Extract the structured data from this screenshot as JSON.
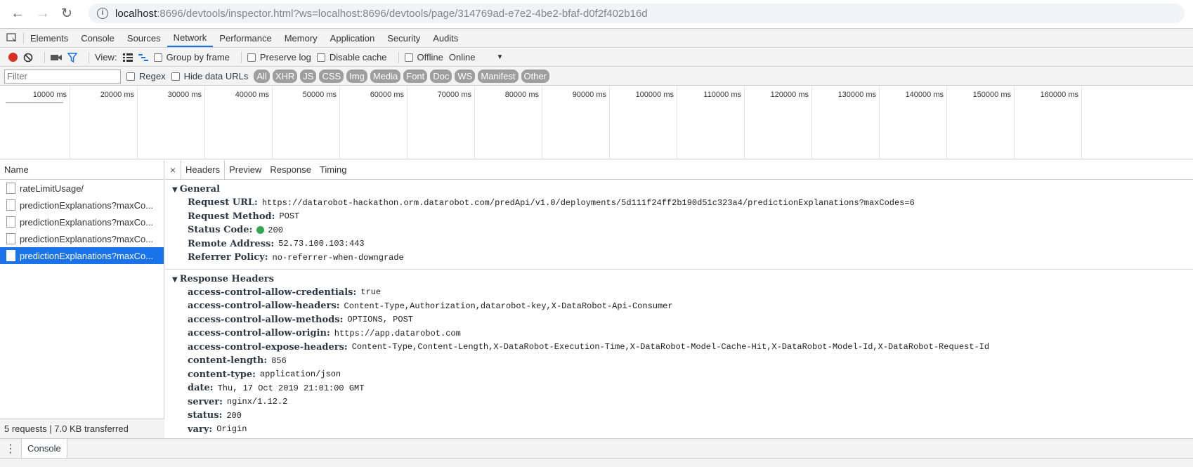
{
  "browser": {
    "url_host": "localhost",
    "url_rest": ":8696/devtools/inspector.html?ws=localhost:8696/devtools/page/314769ad-e7e2-4be2-bfaf-d0f2f402b16d"
  },
  "devtools_tabs": [
    "Elements",
    "Console",
    "Sources",
    "Network",
    "Performance",
    "Memory",
    "Application",
    "Security",
    "Audits"
  ],
  "active_tab": "Network",
  "toolbar": {
    "view_label": "View:",
    "group_by_frame": "Group by frame",
    "preserve_log": "Preserve log",
    "disable_cache": "Disable cache",
    "offline": "Offline",
    "throttle": "Online"
  },
  "filterbar": {
    "placeholder": "Filter",
    "regex": "Regex",
    "hide_data_urls": "Hide data URLs",
    "types": [
      "All",
      "XHR",
      "JS",
      "CSS",
      "Img",
      "Media",
      "Font",
      "Doc",
      "WS",
      "Manifest",
      "Other"
    ]
  },
  "timeline_ticks": [
    "10000 ms",
    "20000 ms",
    "30000 ms",
    "40000 ms",
    "50000 ms",
    "60000 ms",
    "70000 ms",
    "80000 ms",
    "90000 ms",
    "100000 ms",
    "110000 ms",
    "120000 ms",
    "130000 ms",
    "140000 ms",
    "150000 ms",
    "160000 ms"
  ],
  "requests": {
    "header": "Name",
    "items": [
      {
        "name": "rateLimitUsage/"
      },
      {
        "name": "predictionExplanations?maxCo..."
      },
      {
        "name": "predictionExplanations?maxCo..."
      },
      {
        "name": "predictionExplanations?maxCo..."
      },
      {
        "name": "predictionExplanations?maxCo..."
      }
    ],
    "selected_index": 4,
    "footer": "5 requests | 7.0 KB transferred"
  },
  "detail": {
    "tabs": [
      "Headers",
      "Preview",
      "Response",
      "Timing"
    ],
    "active_tab": "Headers",
    "general": {
      "title": "General",
      "rows": [
        {
          "key": "Request URL:",
          "value": "https://datarobot-hackathon.orm.datarobot.com/predApi/v1.0/deployments/5d111f24ff2b190d51c323a4/predictionExplanations?maxCodes=6"
        },
        {
          "key": "Request Method:",
          "value": "POST"
        },
        {
          "key": "Status Code:",
          "value": "200",
          "status_color": "#34a853"
        },
        {
          "key": "Remote Address:",
          "value": "52.73.100.103:443"
        },
        {
          "key": "Referrer Policy:",
          "value": "no-referrer-when-downgrade"
        }
      ]
    },
    "response_headers": {
      "title": "Response Headers",
      "rows": [
        {
          "key": "access-control-allow-credentials:",
          "value": "true"
        },
        {
          "key": "access-control-allow-headers:",
          "value": "Content-Type,Authorization,datarobot-key,X-DataRobot-Api-Consumer"
        },
        {
          "key": "access-control-allow-methods:",
          "value": "OPTIONS, POST"
        },
        {
          "key": "access-control-allow-origin:",
          "value": "https://app.datarobot.com"
        },
        {
          "key": "access-control-expose-headers:",
          "value": "Content-Type,Content-Length,X-DataRobot-Execution-Time,X-DataRobot-Model-Cache-Hit,X-DataRobot-Model-Id,X-DataRobot-Request-Id"
        },
        {
          "key": "content-length:",
          "value": "856"
        },
        {
          "key": "content-type:",
          "value": "application/json"
        },
        {
          "key": "date:",
          "value": "Thu, 17 Oct 2019 21:01:00 GMT"
        },
        {
          "key": "server:",
          "value": "nginx/1.12.2"
        },
        {
          "key": "status:",
          "value": "200"
        },
        {
          "key": "vary:",
          "value": "Origin"
        }
      ]
    }
  },
  "drawer": {
    "tab": "Console"
  },
  "colors": {
    "accent": "#1a73e8",
    "record": "#d93025",
    "status_ok": "#34a853"
  }
}
